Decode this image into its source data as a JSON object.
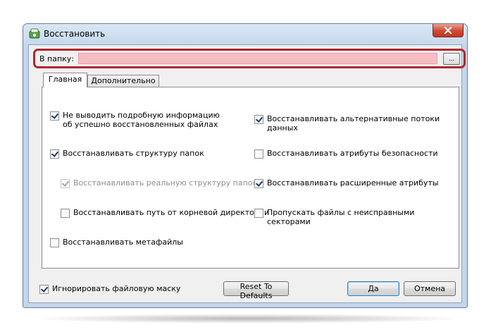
{
  "window": {
    "title": "Восстановить"
  },
  "folder": {
    "label": "В папку:",
    "value": "",
    "browse_label": "..."
  },
  "tabs": [
    {
      "label": "Главная",
      "active": true
    },
    {
      "label": "Дополнительно",
      "active": false
    }
  ],
  "options": {
    "no_verbose": {
      "label": "Не выводить подробную информацию\nоб успешно восстановленных файлах",
      "checked": true,
      "enabled": true
    },
    "restore_folder_structure": {
      "label": "Восстанавливать структуру папок",
      "checked": true,
      "enabled": true
    },
    "restore_real_structure": {
      "label": "Восстанавливать реальную структуру папок",
      "checked": true,
      "enabled": false
    },
    "restore_root_path": {
      "label": "Восстанавливать путь от корневой директории",
      "checked": false,
      "enabled": true
    },
    "restore_metafiles": {
      "label": "Восстанавливать метафайлы",
      "checked": false,
      "enabled": true
    },
    "restore_alt_streams": {
      "label": "Восстанавливать альтернативные потоки данных",
      "checked": true,
      "enabled": true
    },
    "restore_security_attrs": {
      "label": "Восстанавливать атрибуты безопасности",
      "checked": false,
      "enabled": true
    },
    "restore_extended_attrs": {
      "label": "Восстанавливать расширенные атрибуты",
      "checked": true,
      "enabled": true
    },
    "skip_bad_sectors": {
      "label": "Пропускать файлы с неисправными секторами",
      "checked": false,
      "enabled": true
    }
  },
  "footer": {
    "ignore_mask": {
      "label": "Игнорировать файловую маску",
      "checked": true
    },
    "reset_label": "Reset To Defaults",
    "ok_label": "Да",
    "cancel_label": "Отмена"
  },
  "colors": {
    "highlight_border": "#b1262d",
    "input_background": "#f7bcc4",
    "close_button": "#cf4a33"
  }
}
